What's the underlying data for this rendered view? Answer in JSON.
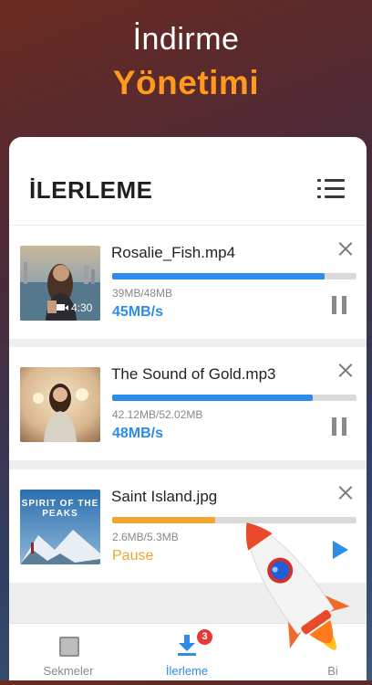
{
  "hero": {
    "line1": "İndirme",
    "line2": "Yönetimi"
  },
  "header": {
    "title": "İLERLEME",
    "menu_icon": "list-menu-icon"
  },
  "downloads": [
    {
      "name": "Rosalie_Fish.mp4",
      "size": "39MB/48MB",
      "speed": "45MB/s",
      "progress": 0.87,
      "state": "downloading",
      "video_duration": "4:30",
      "action_icon": "pause-icon"
    },
    {
      "name": "The Sound of Gold.mp3",
      "size": "42.12MB/52.02MB",
      "speed": "48MB/s",
      "progress": 0.82,
      "state": "downloading",
      "action_icon": "pause-icon"
    },
    {
      "name": "Saint Island.jpg",
      "size": "2.6MB/5.3MB",
      "speed": "Pause",
      "progress": 0.42,
      "state": "paused",
      "action_icon": "play-icon",
      "thumb_text": "SPIRIT OF THE PEAKS"
    }
  ],
  "tabs": [
    {
      "label": "Sekmeler",
      "icon": "tabs-icon",
      "active": false
    },
    {
      "label": "İlerleme",
      "icon": "download-icon",
      "active": true,
      "badge": "3"
    },
    {
      "label": "Bi",
      "icon": "folder-icon",
      "active": false
    }
  ],
  "colors": {
    "accent": "#2e8bea",
    "orange": "#ff9a1f",
    "paused": "#f2a531",
    "badge": "#e53935"
  }
}
